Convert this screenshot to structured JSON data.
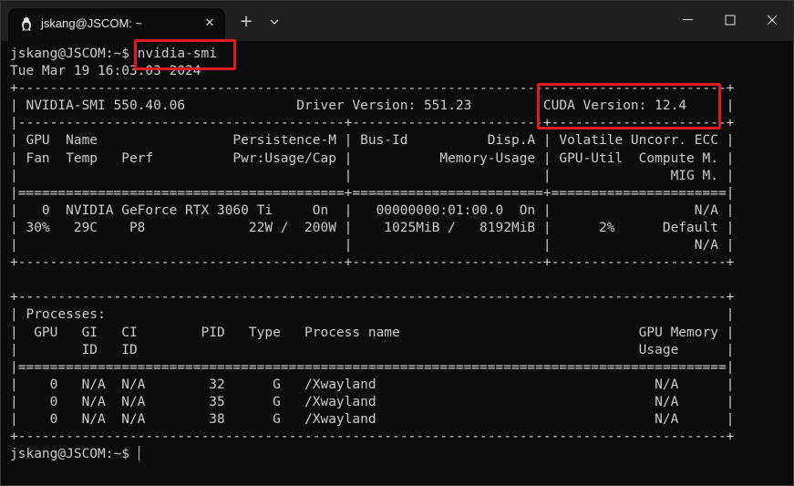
{
  "titlebar": {
    "tab_title": "jskang@JSCOM: ~",
    "close_glyph": "✕",
    "new_tab_glyph": "+"
  },
  "terminal": {
    "lines": [
      "jskang@JSCOM:~$ nvidia-smi",
      "Tue Mar 19 16:03:03 2024",
      "+-----------------------------------------------------------------------------------------+",
      "| NVIDIA-SMI 550.40.06              Driver Version: 551.23         CUDA Version: 12.4     |",
      "|-----------------------------------------+------------------------+----------------------+",
      "| GPU  Name                 Persistence-M | Bus-Id          Disp.A | Volatile Uncorr. ECC |",
      "| Fan  Temp   Perf          Pwr:Usage/Cap |           Memory-Usage | GPU-Util  Compute M. |",
      "|                                         |                        |               MIG M. |",
      "|=========================================+========================+======================|",
      "|   0  NVIDIA GeForce RTX 3060 Ti     On  |   00000000:01:00.0  On |                  N/A |",
      "| 30%   29C    P8             22W /  200W |    1025MiB /   8192MiB |      2%      Default |",
      "|                                         |                        |                  N/A |",
      "+-----------------------------------------+------------------------+----------------------+",
      "",
      "+-----------------------------------------------------------------------------------------+",
      "| Processes:                                                                              |",
      "|  GPU   GI   CI        PID   Type   Process name                              GPU Memory |",
      "|        ID   ID                                                               Usage      |",
      "|=========================================================================================|",
      "|    0   N/A  N/A        32      G   /Xwayland                                   N/A      |",
      "|    0   N/A  N/A        35      G   /Xwayland                                   N/A      |",
      "|    0   N/A  N/A        38      G   /Xwayland                                   N/A      |",
      "+-----------------------------------------------------------------------------------------+"
    ],
    "final_prompt": "jskang@JSCOM:~$ "
  },
  "colors": {
    "highlight": "#e01a22",
    "text": "#cccccc",
    "background": "#0c0c0c",
    "titlebar": "#202020"
  }
}
